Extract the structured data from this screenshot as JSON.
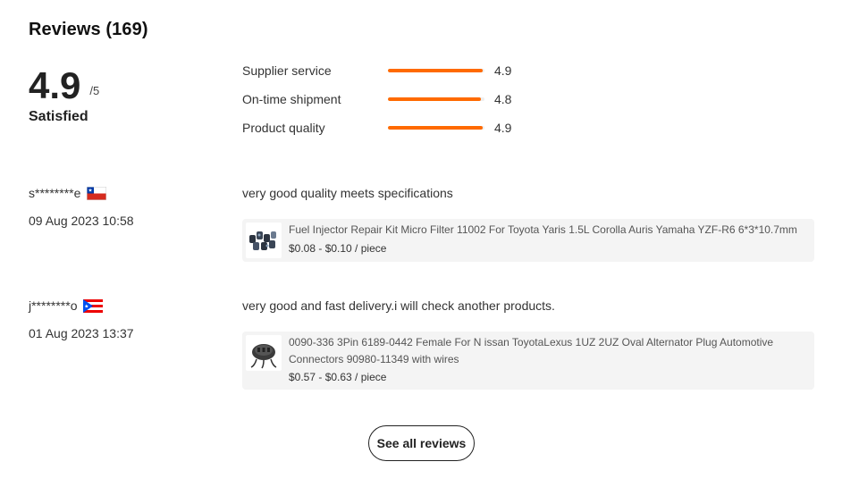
{
  "section": {
    "title": "Reviews (169)"
  },
  "summary": {
    "score": "4.9",
    "out_of": "/5",
    "verdict": "Satisfied"
  },
  "metrics": [
    {
      "label": "Supplier service",
      "value": "4.9",
      "fill_fraction": 0.98,
      "color": "#ff6a00"
    },
    {
      "label": "On-time shipment",
      "value": "4.8",
      "fill_fraction": 0.96,
      "color": "#ff6a00"
    },
    {
      "label": "Product quality",
      "value": "4.9",
      "fill_fraction": 0.98,
      "color": "#ff6a00"
    }
  ],
  "reviews": [
    {
      "user": "s********e",
      "flag": "chile-flag",
      "date": "09 Aug 2023 10:58",
      "comment": "very good quality meets specifications",
      "product": {
        "name": "Fuel Injector Repair Kit Micro Filter 11002 For Toyota Yaris 1.5L Corolla Auris Yamaha YZF-R6 6*3*10.7mm",
        "price": "$0.08 - $0.10 / piece",
        "thumb_icon": "fuel-injector-filters-thumbnail"
      }
    },
    {
      "user": "j********o",
      "flag": "puerto-rico-flag",
      "date": "01 Aug 2023 13:37",
      "comment": "very good and fast delivery.i will check another products.",
      "product": {
        "name": "0090-336 3Pin 6189-0442 Female For N issan ToyotaLexus 1UZ 2UZ Oval Alternator Plug Automotive Connectors 90980-11349 with wires",
        "price": "$0.57 - $0.63 / piece",
        "thumb_icon": "connector-plug-thumbnail"
      }
    }
  ],
  "actions": {
    "see_all_label": "See all reviews"
  }
}
